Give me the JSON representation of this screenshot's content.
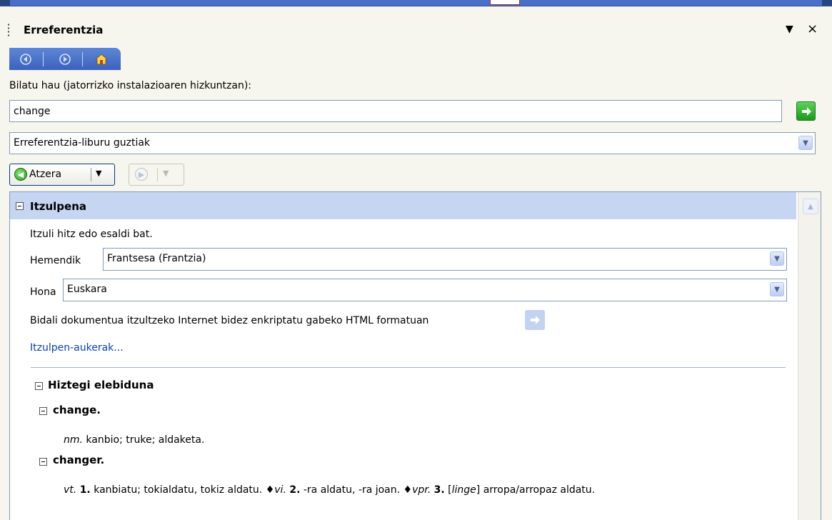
{
  "pane": {
    "title": "Erreferentzia",
    "dropdown_glyph": "▼",
    "close_glyph": "×"
  },
  "nav": {
    "back_icon": "nav-back-icon",
    "forward_icon": "nav-forward-icon",
    "home_icon": "home-icon"
  },
  "search": {
    "label": "Bilatu hau (jatorrizko instalazioaren hizkuntzan):",
    "value": "change",
    "go_icon": "go-arrow-icon"
  },
  "source": {
    "selected": "Erreferentzia-liburu guztiak"
  },
  "toolbar": {
    "back_label": "Atzera"
  },
  "translation": {
    "title": "Itzulpena",
    "description": "Itzuli hitz edo esaldi bat.",
    "from_label": "Hemendik",
    "from_value": "Frantsesa (Frantzia)",
    "to_label": "Hona",
    "to_value": "Euskara",
    "send_text": "Bidali dokumentua itzultzeko Internet bidez enkriptatu gabeko HTML formatuan",
    "options_link": "Itzulpen-aukerak..."
  },
  "dictionary": {
    "title": "Hiztegi elebiduna",
    "entries": [
      {
        "headword": "change.",
        "pos": "nm.",
        "definition": "kanbio; truke; aldaketa."
      },
      {
        "headword": "changer.",
        "pos": "vt.",
        "sense1_num": "1.",
        "sense1": "kanbiatu; tokialdatu, tokiz aldatu.",
        "pos2": "vi.",
        "sense2_num": "2.",
        "sense2": "-ra aldatu, -ra joan.",
        "pos3": "vpr.",
        "sense3_num": "3.",
        "sense3_tag": "linge",
        "sense3": "arropa/arropaz aldatu."
      }
    ]
  },
  "colors": {
    "accent_blue": "#3a62bd",
    "section_header": "#c5d5f2",
    "go_green": "#1b9a1b",
    "link": "#0a3fb0"
  }
}
